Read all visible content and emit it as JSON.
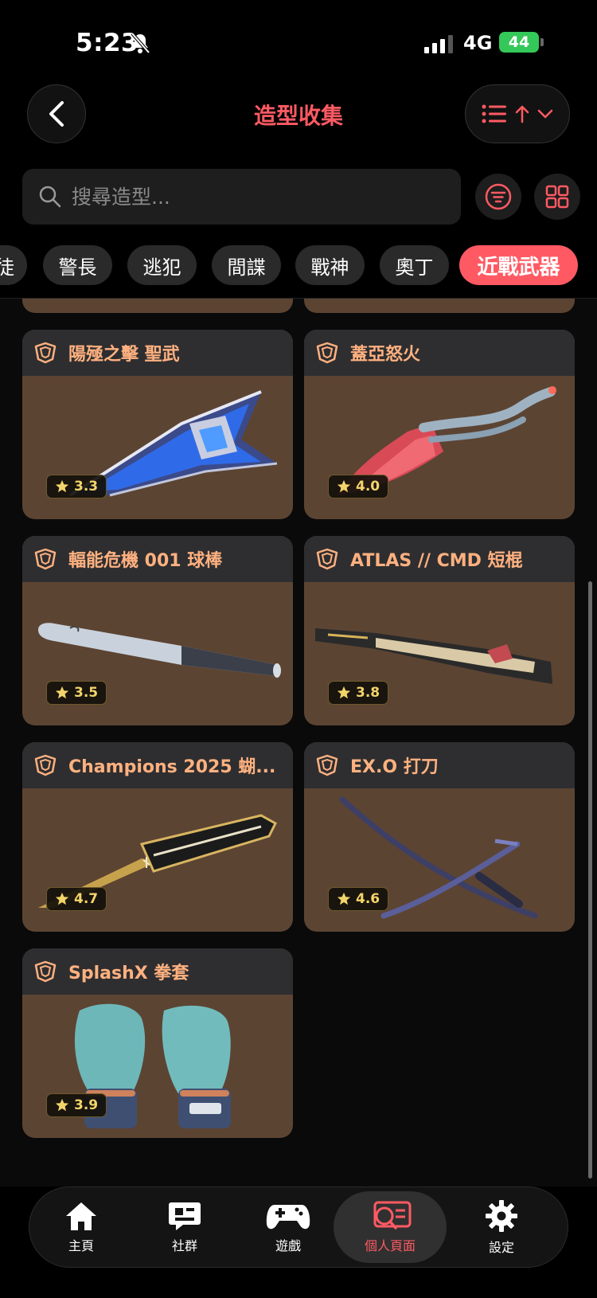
{
  "status_bar": {
    "time": "5:23",
    "network": "4G",
    "battery": "44"
  },
  "header": {
    "title": "造型收集"
  },
  "search": {
    "placeholder": "搜尋造型..."
  },
  "categories": [
    {
      "label": "徒",
      "active": false
    },
    {
      "label": "警長",
      "active": false
    },
    {
      "label": "逃犯",
      "active": false
    },
    {
      "label": "間諜",
      "active": false
    },
    {
      "label": "戰神",
      "active": false
    },
    {
      "label": "奧丁",
      "active": false
    },
    {
      "label": "近戰武器",
      "active": true
    }
  ],
  "cards": [
    {
      "name": "陽殛之擊 聖武",
      "rating": "3.3",
      "art": "blade-icon"
    },
    {
      "name": "蓋亞怒火",
      "rating": "4.0",
      "art": "vine-knife-icon"
    },
    {
      "name": "輻能危機 001 球棒",
      "rating": "3.5",
      "art": "bat-icon"
    },
    {
      "name": "ATLAS // CMD 短棍",
      "rating": "3.8",
      "art": "baton-icon"
    },
    {
      "name": "Champions 2025 蝴...",
      "rating": "4.7",
      "art": "butterfly-knife-icon"
    },
    {
      "name": "EX.O 打刀",
      "rating": "4.6",
      "art": "katana-icon"
    },
    {
      "name": "SplashX 拳套",
      "rating": "3.9",
      "art": "gloves-icon"
    }
  ],
  "nav": [
    {
      "label": "主頁",
      "icon": "home-icon",
      "active": false
    },
    {
      "label": "社群",
      "icon": "chat-icon",
      "active": false
    },
    {
      "label": "遊戲",
      "icon": "gamepad-icon",
      "active": false
    },
    {
      "label": "個人頁面",
      "icon": "profile-search-icon",
      "active": true
    },
    {
      "label": "設定",
      "icon": "gear-icon",
      "active": false
    }
  ],
  "colors": {
    "accent": "#ff5a63",
    "card_body": "#5c4433",
    "card_head": "#2e2e30",
    "card_name": "#ffb180",
    "rating_star": "#f3d46b"
  }
}
